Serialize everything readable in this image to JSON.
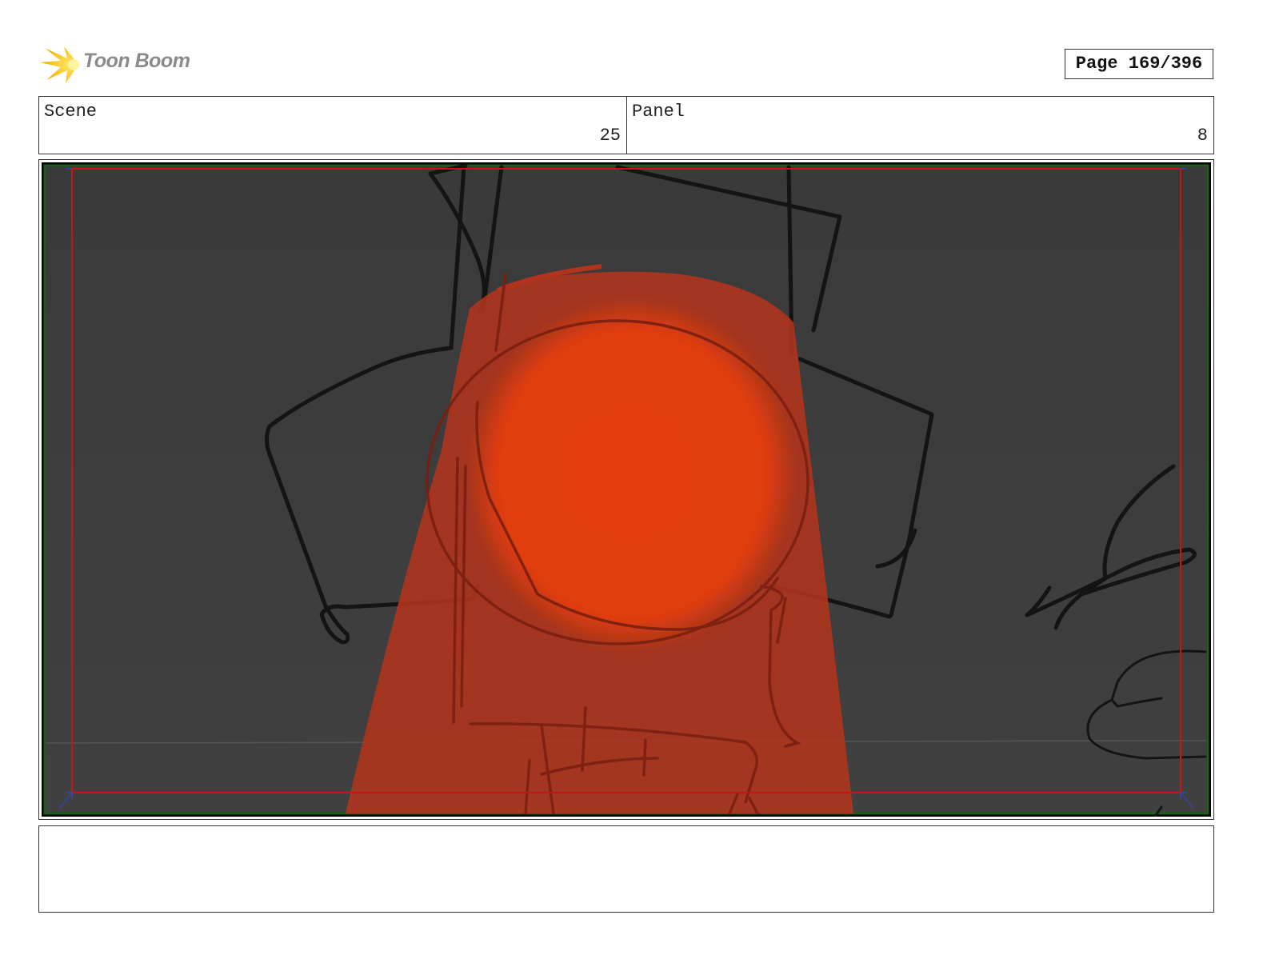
{
  "header": {
    "logo_text": "Toon Boom",
    "page_label": "Page 169/396"
  },
  "fields": {
    "scene_label": "Scene",
    "scene_value": "25",
    "panel_label": "Panel",
    "panel_value": "8"
  },
  "notes": {
    "text": ""
  },
  "colors": {
    "logo_star": "#f5c000",
    "logo_text": "#8a8a8a",
    "frame_background": "#3b3b3b",
    "safe_area_line": "#c81414",
    "light_beam": "#b3341c",
    "glow": "#e8410c",
    "sketch_lines": "#141414"
  }
}
